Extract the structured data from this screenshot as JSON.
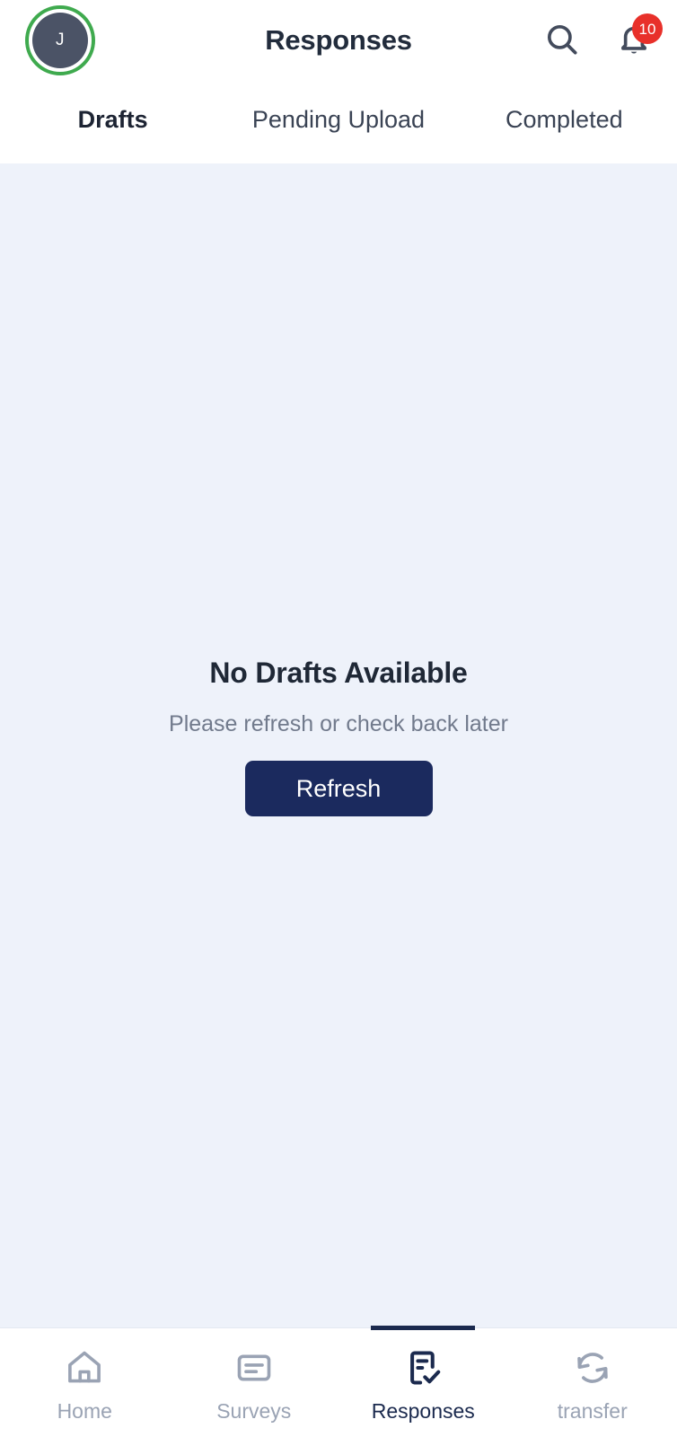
{
  "header": {
    "title": "Responses",
    "avatar_initial": "J",
    "avatar_ring_color": "#3faa4e",
    "avatar_bg_color": "#4b5366",
    "search_icon": "search-icon",
    "notifications_icon": "bell-icon",
    "notifications_count": "10",
    "badge_color": "#e8302a"
  },
  "tabs": {
    "active_index": 0,
    "items": [
      {
        "label": "Drafts",
        "active": true
      },
      {
        "label": "Pending Upload",
        "active": false
      },
      {
        "label": "Completed",
        "active": false
      }
    ],
    "indicator_color": "#232c3b"
  },
  "content": {
    "background_color": "#eef2fa",
    "empty_state": {
      "title": "No Drafts Available",
      "subtitle": "Please refresh or check back later",
      "button_label": "Refresh",
      "button_color": "#1b2a5e"
    }
  },
  "bottom_nav": {
    "active_index": 2,
    "active_color": "#1b2a4e",
    "inactive_color": "#9aa3b4",
    "items": [
      {
        "label": "Home",
        "icon": "home-icon",
        "active": false
      },
      {
        "label": "Surveys",
        "icon": "survey-document-icon",
        "active": false
      },
      {
        "label": "Responses",
        "icon": "document-check-icon",
        "active": true
      },
      {
        "label": "transfer",
        "icon": "sync-arrows-icon",
        "active": false
      }
    ]
  }
}
